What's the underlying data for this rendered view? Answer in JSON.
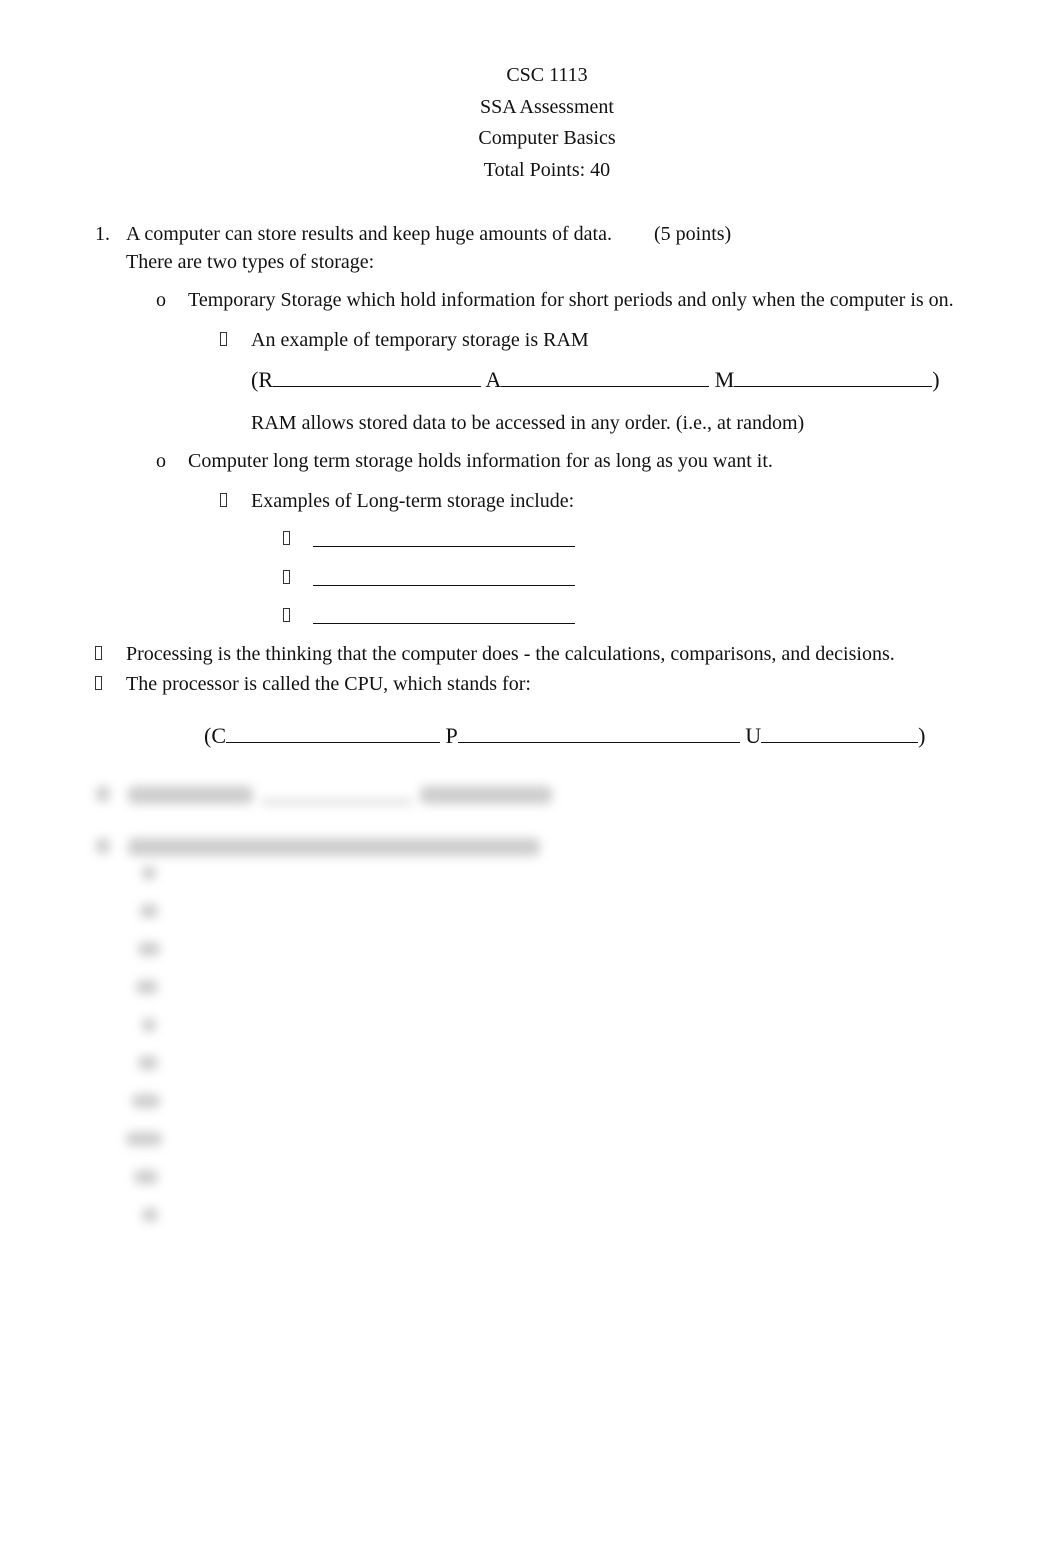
{
  "header": {
    "course": "CSC 1113",
    "assessment": "SSA Assessment",
    "topic": "Computer Basics",
    "total_points": "Total Points: 40"
  },
  "question1": {
    "number": "1.",
    "text": "A computer can store results and keep huge amounts of data.",
    "points": "(5 points)",
    "intro": "There are two types of storage:",
    "sub_bullet_glyph": "o",
    "temporary": {
      "text": "Temporary Storage which hold information for short periods and only when the computer is on.",
      "example": "An example of temporary storage is RAM",
      "acronym": {
        "open": "(",
        "letters": [
          "R",
          "A",
          "M"
        ],
        "close": ")"
      },
      "note": "RAM allows stored data to be accessed in any order. (i.e., at random)"
    },
    "long_term": {
      "text": "Computer long term storage holds information for as long as you want it.",
      "examples_intro": "Examples of Long-term storage include:",
      "answer_blanks": 3
    }
  },
  "processing": {
    "bullets": [
      "Processing is the thinking that the computer does - the calculations, comparisons, and decisions.",
      "The processor is called the CPU, which stands for:"
    ],
    "acronym": {
      "open": "(",
      "letters": [
        "C",
        "P",
        "U"
      ],
      "close": ")"
    }
  },
  "preview_notice": {
    "blurred": true
  }
}
